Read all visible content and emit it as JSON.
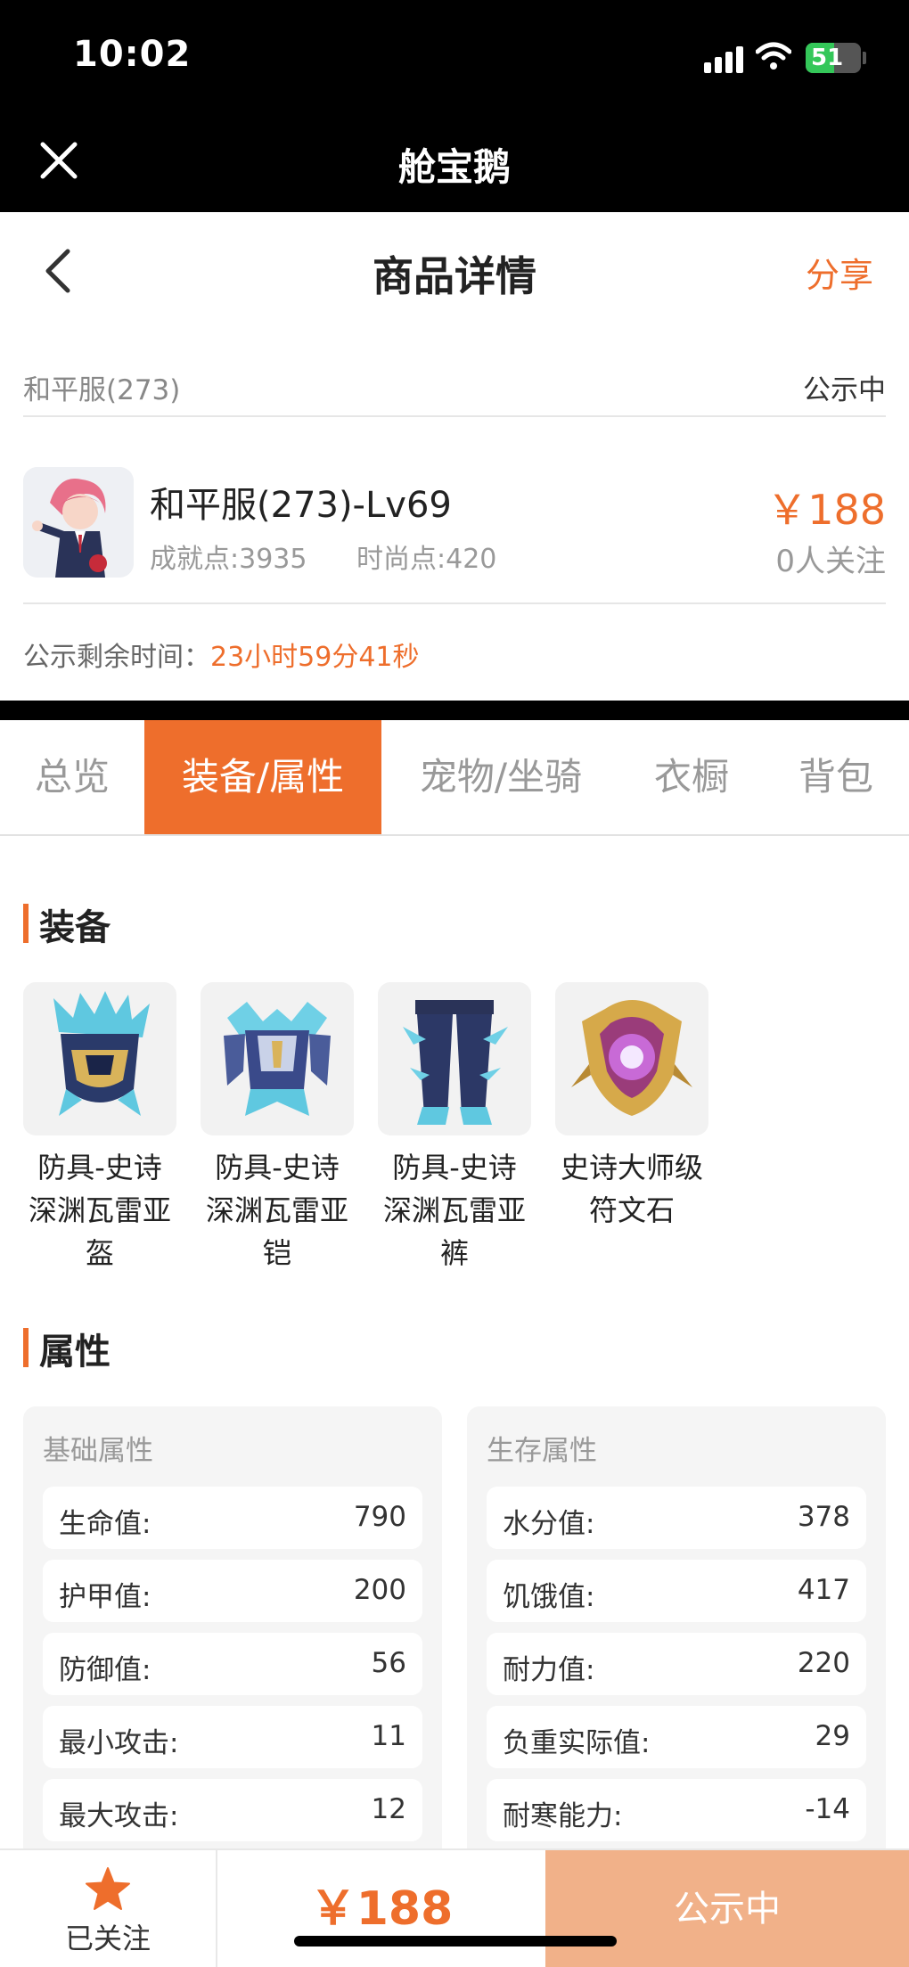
{
  "status_bar": {
    "time": "10:02",
    "battery": "51"
  },
  "app_bar": {
    "title": "舱宝鹅"
  },
  "page_header": {
    "title": "商品详情",
    "share": "分享"
  },
  "server": {
    "name": "和平服(273)",
    "status": "公示中"
  },
  "product": {
    "name": "和平服(273)-Lv69",
    "achievement": "成就点:3935",
    "fashion": "时尚点:420",
    "price": "￥188",
    "followers": "0人关注"
  },
  "countdown": {
    "label": "公示剩余时间：",
    "value": "23小时59分41秒"
  },
  "tabs": [
    {
      "label": "总览"
    },
    {
      "label": "装备/属性"
    },
    {
      "label": "宠物/坐骑"
    },
    {
      "label": "衣橱"
    },
    {
      "label": "背包"
    }
  ],
  "equipment": {
    "title": "装备",
    "items": [
      {
        "line1": "防具-史诗",
        "line2": "深渊瓦雷亚",
        "line3": "盔",
        "icon": "helmet-icon"
      },
      {
        "line1": "防具-史诗",
        "line2": "深渊瓦雷亚",
        "line3": "铠",
        "icon": "armor-icon"
      },
      {
        "line1": "防具-史诗",
        "line2": "深渊瓦雷亚",
        "line3": "裤",
        "icon": "pants-icon"
      },
      {
        "line1": "史诗大师级",
        "line2": "符文石",
        "line3": "",
        "icon": "rune-stone-icon"
      }
    ]
  },
  "attributes": {
    "title": "属性",
    "basic": {
      "title": "基础属性",
      "rows": [
        {
          "k": "生命值:",
          "v": "790"
        },
        {
          "k": "护甲值:",
          "v": "200"
        },
        {
          "k": "防御值:",
          "v": "56"
        },
        {
          "k": "最小攻击:",
          "v": "11"
        },
        {
          "k": "最大攻击:",
          "v": "12"
        }
      ]
    },
    "survival": {
      "title": "生存属性",
      "rows": [
        {
          "k": "水分值:",
          "v": "378"
        },
        {
          "k": "饥饿值:",
          "v": "417"
        },
        {
          "k": "耐力值:",
          "v": "220"
        },
        {
          "k": "负重实际值:",
          "v": "29"
        },
        {
          "k": "耐寒能力:",
          "v": "-14"
        }
      ]
    }
  },
  "bottom_bar": {
    "follow_label": "已关注",
    "price": "￥188",
    "status": "公示中"
  },
  "colors": {
    "accent": "#ee6e2c",
    "accent_light": "#f1b189",
    "bar_black": "#000000"
  }
}
